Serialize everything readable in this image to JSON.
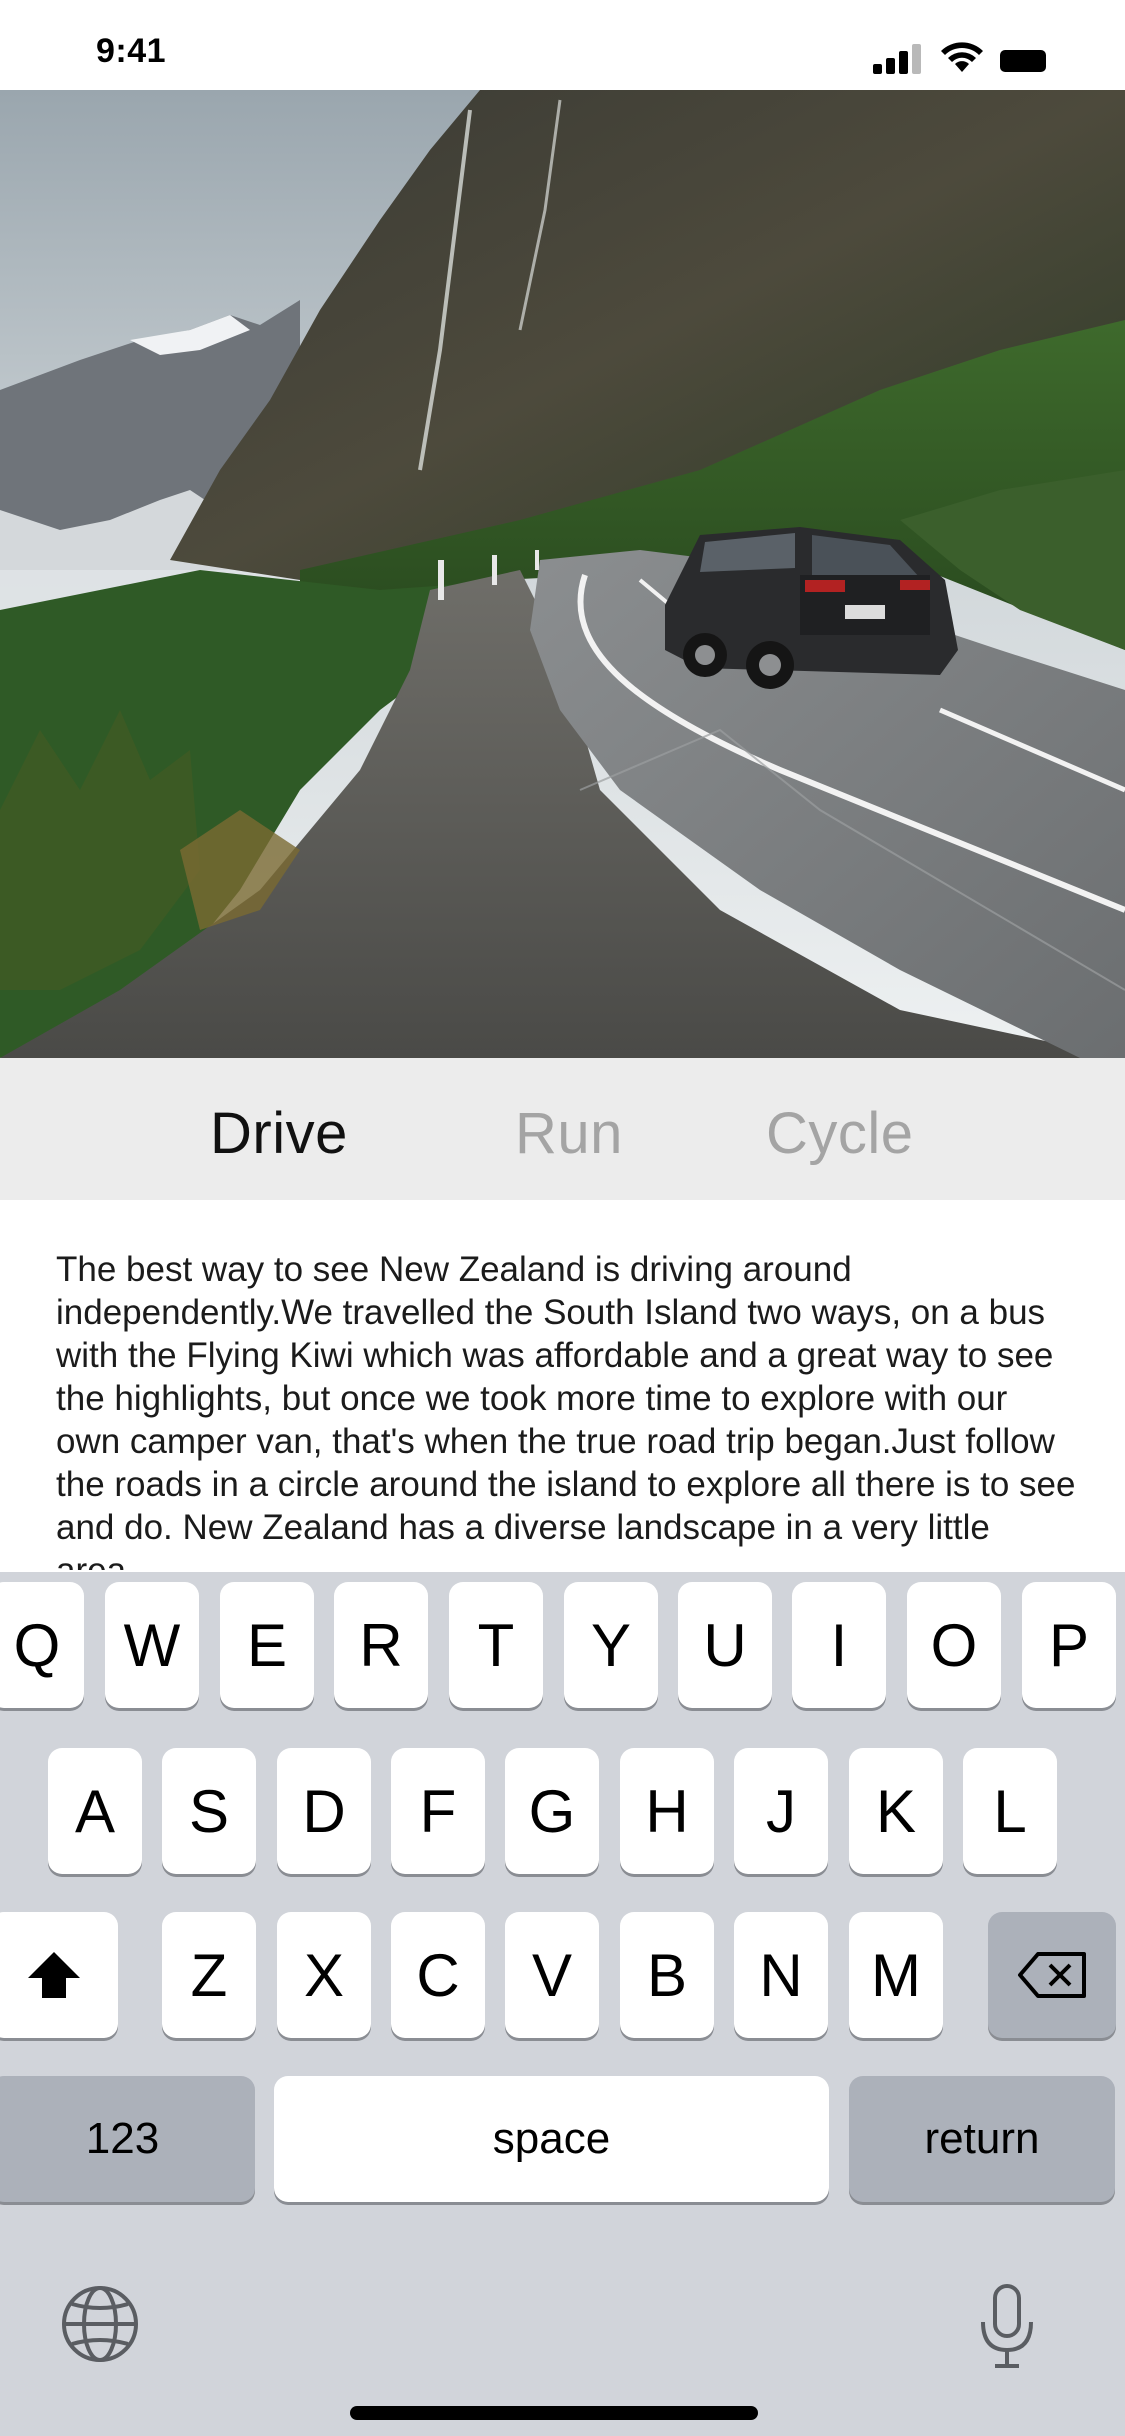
{
  "status": {
    "time": "9:41"
  },
  "tabs": [
    {
      "label": "Drive",
      "selected": true
    },
    {
      "label": "Run",
      "selected": false
    },
    {
      "label": "Cycle",
      "selected": false
    }
  ],
  "article": {
    "text": "The best way to see New Zealand is driving around independently.We travelled the South Island two ways, on a bus with the Flying Kiwi which was affordable and a great way to see the highlights, but once we took more time to explore with our own camper van, that's when the true road trip began.Just follow the roads in a circle around the island to explore all there is to see and do. New Zealand has a diverse landscape in a very little area."
  },
  "keyboard": {
    "row1": [
      "Q",
      "W",
      "E",
      "R",
      "T",
      "Y",
      "U",
      "I",
      "O",
      "P"
    ],
    "row2": [
      "A",
      "S",
      "D",
      "F",
      "G",
      "H",
      "J",
      "K",
      "L"
    ],
    "row3": [
      "Z",
      "X",
      "C",
      "V",
      "B",
      "N",
      "M"
    ],
    "numbers_label": "123",
    "space_label": "space",
    "return_label": "return",
    "icons": [
      "shift-icon",
      "delete-icon",
      "globe-icon",
      "microphone-icon"
    ]
  },
  "colors": {
    "tab_selected": "#111111",
    "tab_unselected": "#a4a4a4",
    "keyboard_bg": "#d1d4da",
    "dark_key": "#acb1ba"
  }
}
